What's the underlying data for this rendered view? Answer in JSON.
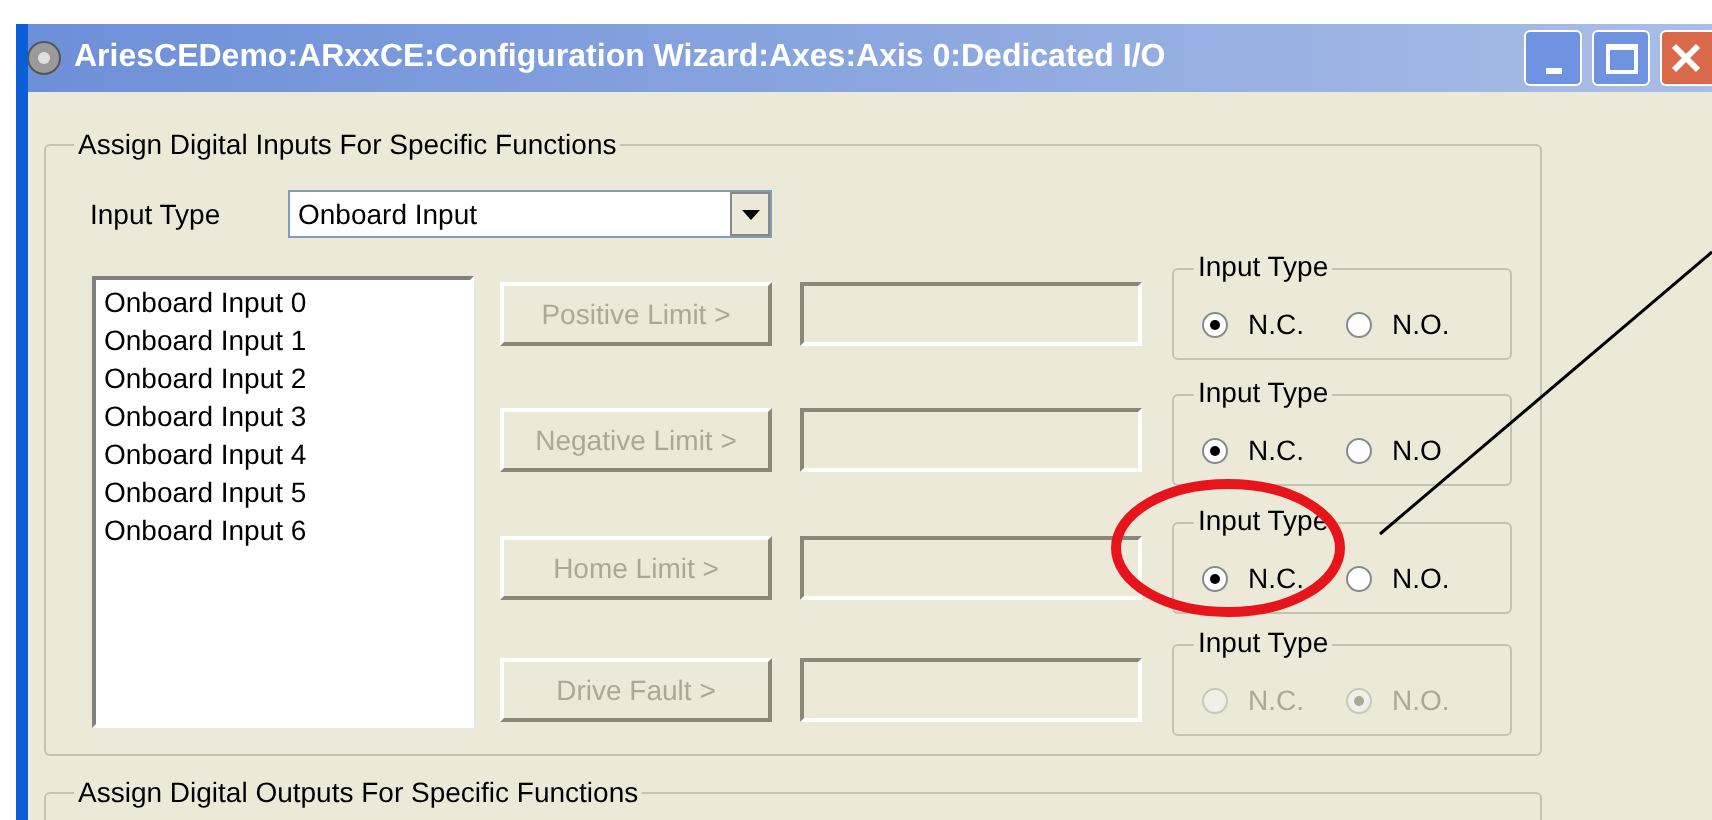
{
  "window": {
    "title": "AriesCEDemo:ARxxCE:Configuration Wizard:Axes:Axis 0:Dedicated I/O"
  },
  "inputs_group": {
    "title": "Assign Digital Inputs For Specific Functions",
    "input_type": {
      "label": "Input Type",
      "value": "Onboard Input"
    },
    "list_items": [
      "Onboard Input 0",
      "Onboard Input 1",
      "Onboard Input 2",
      "Onboard Input 3",
      "Onboard Input 4",
      "Onboard Input 5",
      "Onboard Input 6"
    ],
    "functions": [
      {
        "button": "Positive Limit >",
        "disabled": true,
        "input_type": {
          "label": "Input Type",
          "disabled": false,
          "options": [
            {
              "label": "N.C.",
              "selected": true
            },
            {
              "label": "N.O.",
              "selected": false
            }
          ]
        }
      },
      {
        "button": "Negative Limit >",
        "disabled": true,
        "input_type": {
          "label": "Input Type",
          "disabled": false,
          "options": [
            {
              "label": "N.C.",
              "selected": true
            },
            {
              "label": "N.O",
              "selected": false
            }
          ]
        }
      },
      {
        "button": "Home Limit >",
        "disabled": true,
        "input_type": {
          "label": "Input Type",
          "disabled": false,
          "options": [
            {
              "label": "N.C.",
              "selected": true
            },
            {
              "label": "N.O.",
              "selected": false
            }
          ]
        }
      },
      {
        "button": "Drive Fault >",
        "disabled": true,
        "input_type": {
          "label": "Input Type",
          "disabled": true,
          "options": [
            {
              "label": "N.C.",
              "selected": false
            },
            {
              "label": "N.O.",
              "selected": true
            }
          ]
        }
      }
    ]
  },
  "outputs_group": {
    "title": "Assign Digital Outputs For Specific Functions"
  }
}
